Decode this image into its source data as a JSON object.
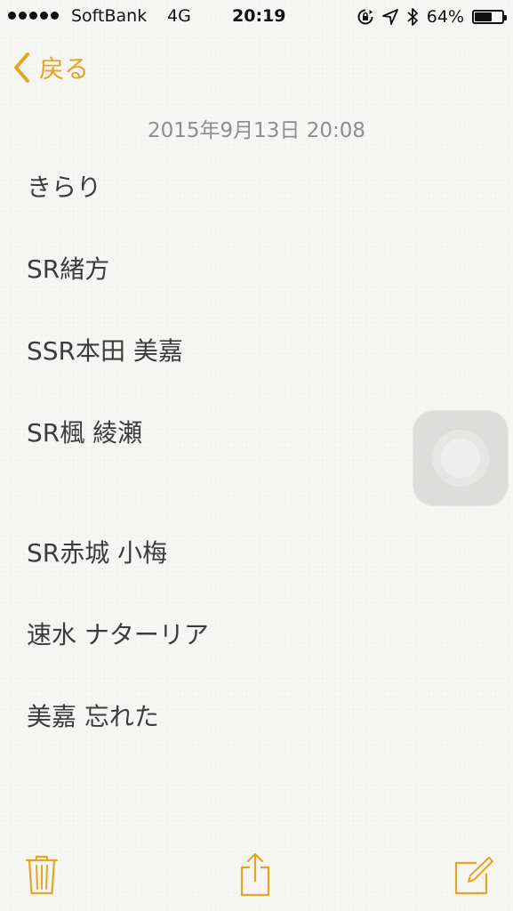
{
  "status_bar": {
    "carrier": "SoftBank",
    "network": "4G",
    "time": "20:19",
    "battery_percent_label": "64%",
    "battery_level": 0.64,
    "icons": [
      "signal-dots-icon",
      "rotation-lock-icon",
      "location-arrow-icon",
      "bluetooth-icon",
      "battery-icon"
    ]
  },
  "nav": {
    "back_label": "戻る",
    "back_icon": "chevron-left-icon"
  },
  "note": {
    "date": "2015年9月13日 20:08",
    "lines": [
      "きらり",
      "SR緒方",
      "SSR本田 美嘉",
      "SR楓 綾瀬",
      "SR赤城 小梅",
      "速水 ナターリア",
      "美嘉 忘れた"
    ]
  },
  "toolbar": {
    "icons": [
      "trash-icon",
      "share-icon",
      "compose-icon"
    ]
  },
  "colors": {
    "accent": "#e4a523",
    "background": "#f6f6f4",
    "text": "#3c3c3c",
    "date_text": "#8e8e8e"
  }
}
